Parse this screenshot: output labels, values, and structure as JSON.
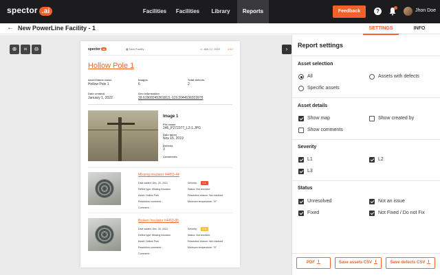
{
  "app": {
    "logo_text": "spector",
    "logo_badge": ".ai",
    "username": "Jhon Doe",
    "feedback_label": "Feedback",
    "help_glyph": "?"
  },
  "nav": [
    {
      "label": "Facilities"
    },
    {
      "label": "Facilities"
    },
    {
      "label": "Library"
    },
    {
      "label": "Reports",
      "active": true
    }
  ],
  "header": {
    "title": "New PowerLine Facility - 1",
    "back_glyph": "←"
  },
  "tabs": {
    "settings": "SETTINGS",
    "info": "INFO"
  },
  "preview": {
    "tools": [
      "zoom-in-icon",
      "fit-screen-icon",
      "zoom-out-icon"
    ],
    "tool_glyphs": [
      "⊕",
      "⌗",
      "⊖"
    ],
    "collapse_glyph": "›",
    "paper": {
      "logo_text": "spector",
      "logo_badge": "ai",
      "facility": "New Facility",
      "date": "JAN 17, 2022",
      "page": "1/10",
      "pole_title": "Hollow Pole 1",
      "asset_name_label": "Asset Name name",
      "asset_name": "Hollow Pole 1",
      "images_label": "Images",
      "images": "6",
      "defects_label": "Total defects",
      "defects": "2",
      "created_label": "Date created",
      "created": "January 1, 2022",
      "geo_label": "Geo information",
      "geo": "39.61909245261813,-119.2044536023976",
      "image_heading": "Image 1",
      "file_label": "File name",
      "file": "246_P272377_L2-1.JPG",
      "taken_label": "Date taken",
      "taken": "Nov 15, 2019",
      "img_defects_label": "Defects",
      "img_defects": "3",
      "comments_label": "Comments",
      "defect_items": [
        {
          "title": "Missing insulator #4453-44",
          "date_added": "Date added: Dec. 20, 2021",
          "defect_type": "Defect type: Missing insulator",
          "asset": "Asset: Hollow Pole",
          "resolution_comment": "Resolution comment: -",
          "comment": "Comment: -",
          "severity": "Severity:",
          "severity_badge": "L1",
          "status": "Status: Not resolved",
          "resolution_reason": "Resolution reason: Not resolved",
          "min_temp": "Minimum temperature: 70°",
          "badge_color": "#e8503a"
        },
        {
          "title": "Broken Insulator #4453-35",
          "date_added": "Date added: Dec. 20, 2021",
          "defect_type": "Defect type: Missing insulator",
          "asset": "Asset: Hollow Pole",
          "resolution_comment": "Resolution comment: -",
          "comment": "Comment: -",
          "severity": "Severity:",
          "severity_badge": "L2",
          "status": "Status: Not resolved",
          "resolution_reason": "Resolution reason: Not resolved",
          "min_temp": "Minimum temperature: 70°",
          "badge_color": "#f2c23a"
        }
      ]
    }
  },
  "settings": {
    "title": "Report settings",
    "asset_selection": {
      "title": "Asset selection",
      "options": [
        {
          "label": "All",
          "selected": true
        },
        {
          "label": "Assets with defects",
          "selected": false
        },
        {
          "label": "Specific assets",
          "selected": false
        }
      ]
    },
    "asset_details": {
      "title": "Asset details",
      "options": [
        {
          "label": "Show map",
          "checked": true
        },
        {
          "label": "Show created by",
          "checked": false
        },
        {
          "label": "Show comments",
          "checked": false
        }
      ]
    },
    "severity": {
      "title": "Severity",
      "options": [
        {
          "label": "L1",
          "checked": true
        },
        {
          "label": "L2",
          "checked": true
        },
        {
          "label": "L3",
          "checked": true
        }
      ]
    },
    "status": {
      "title": "Status",
      "options": [
        {
          "label": "Unresolved",
          "checked": true
        },
        {
          "label": "Not an issue",
          "checked": true
        },
        {
          "label": "Fixed",
          "checked": true
        },
        {
          "label": "Not Fixed / Do not Fix",
          "checked": true
        }
      ]
    },
    "footer": {
      "pdf": "PDF",
      "assets_csv": "Save assets CSV",
      "defects_csv": "Save defects CSV"
    }
  },
  "colors": {
    "accent": "#f0612b",
    "topbar": "#1c1c1e"
  }
}
